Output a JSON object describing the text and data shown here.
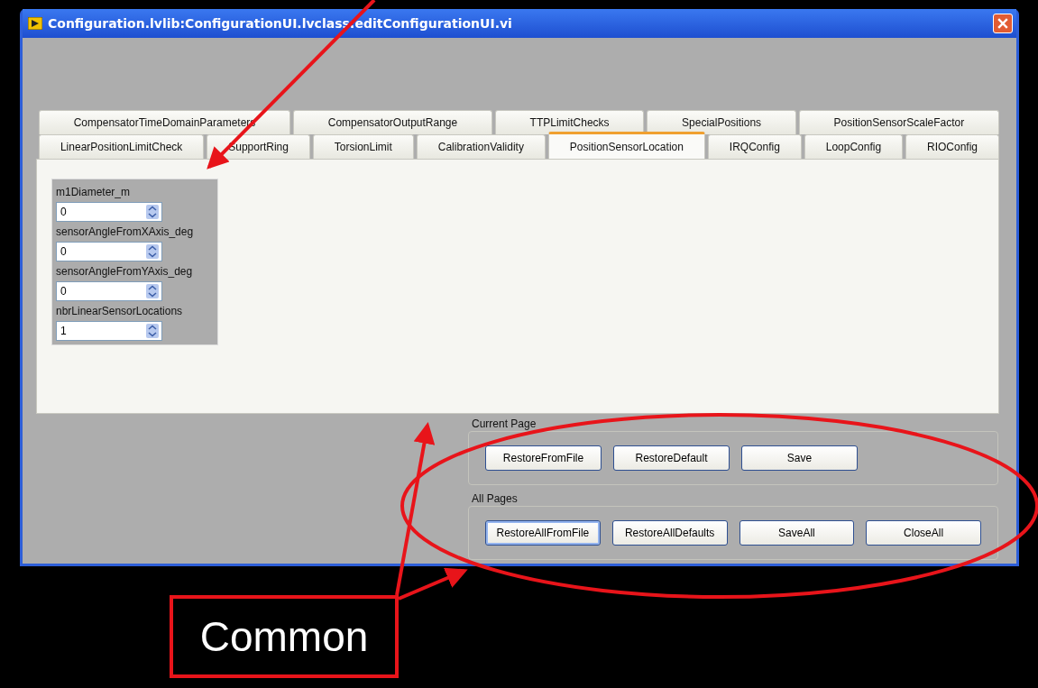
{
  "window": {
    "title": "Configuration.lvlib:ConfigurationUI.lvclass:editConfigurationUI.vi"
  },
  "tab_rows": [
    [
      {
        "label": "CompensatorTimeDomainParameters",
        "selected": false
      },
      {
        "label": "CompensatorOutputRange",
        "selected": false
      },
      {
        "label": "TTPLimitChecks",
        "selected": false
      },
      {
        "label": "SpecialPositions",
        "selected": false
      },
      {
        "label": "PositionSensorScaleFactor",
        "selected": false
      }
    ],
    [
      {
        "label": "LinearPositionLimitCheck",
        "selected": false
      },
      {
        "label": "SupportRing",
        "selected": false
      },
      {
        "label": "TorsionLimit",
        "selected": false
      },
      {
        "label": "CalibrationValidity",
        "selected": false
      },
      {
        "label": "PositionSensorLocation",
        "selected": true
      },
      {
        "label": "IRQConfig",
        "selected": false
      },
      {
        "label": "LoopConfig",
        "selected": false
      },
      {
        "label": "RIOConfig",
        "selected": false
      }
    ]
  ],
  "controls": [
    {
      "label": "m1Diameter_m",
      "value": "0"
    },
    {
      "label": "sensorAngleFromXAxis_deg",
      "value": "0"
    },
    {
      "label": "sensorAngleFromYAxis_deg",
      "value": "0"
    },
    {
      "label": "nbrLinearSensorLocations",
      "value": "1"
    }
  ],
  "groups": [
    {
      "title": "Current Page",
      "buttons": [
        {
          "label": "RestoreFromFile",
          "focused": false
        },
        {
          "label": "RestoreDefault",
          "focused": false
        },
        {
          "label": "Save",
          "focused": false
        }
      ]
    },
    {
      "title": "All Pages",
      "buttons": [
        {
          "label": "RestoreAllFromFile",
          "focused": true
        },
        {
          "label": "RestoreAllDefaults",
          "focused": false
        },
        {
          "label": "SaveAll",
          "focused": false
        },
        {
          "label": "CloseAll",
          "focused": false
        }
      ]
    }
  ],
  "annotation": {
    "callout": "Common"
  }
}
